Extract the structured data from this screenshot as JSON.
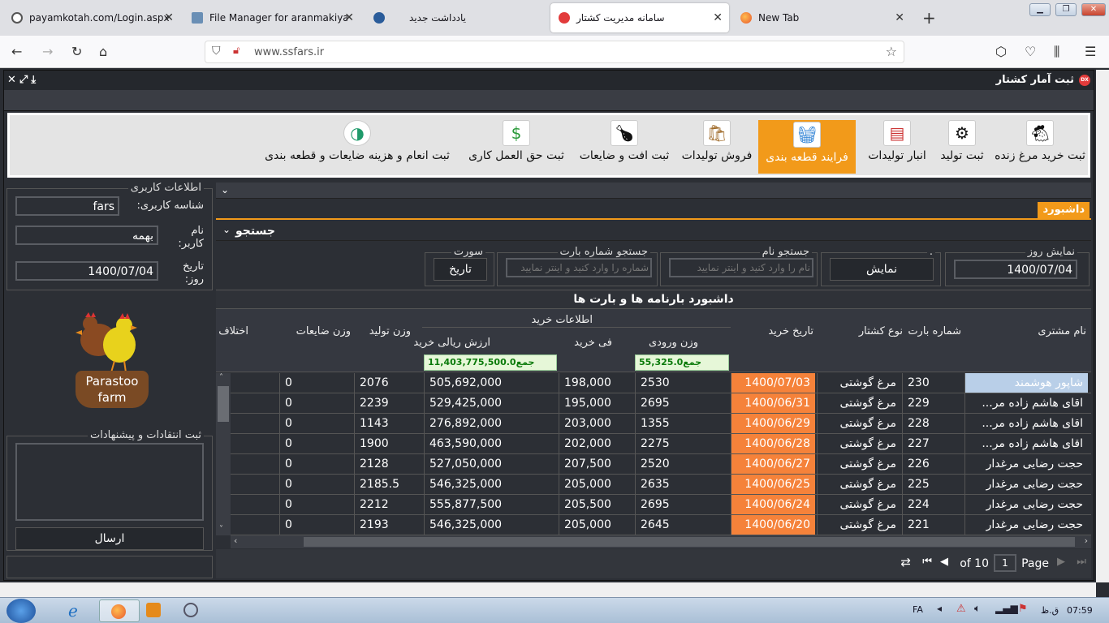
{
  "browser": {
    "tabs": [
      {
        "label": "payamkotah.com/Login.aspx",
        "close": "✕"
      },
      {
        "label": "File Manager for aranmakiyan.ir",
        "close": "✕"
      },
      {
        "label": "",
        "close": ""
      },
      {
        "label": "یادداشت جدید",
        "close": ""
      },
      {
        "label": "سامانه مدیریت کشتار",
        "close": "✕"
      },
      {
        "label": "New Tab",
        "close": "✕"
      }
    ],
    "new_tab": "+",
    "url": "www.ssfars.ir"
  },
  "app": {
    "title": "ثبت آمار کشتار",
    "title_logo": "DX",
    "ribbon": [
      {
        "label": "ثبت خرید مرغ زنده",
        "icon": "hen-icon"
      },
      {
        "label": "ثبت تولید",
        "icon": "production-icon"
      },
      {
        "label": "انبار تولیدات",
        "icon": "warehouse-icon"
      },
      {
        "label": "فرایند قطعه بندی",
        "icon": "basket-icon"
      },
      {
        "label": "فروش تولیدات",
        "icon": "sales-icon"
      },
      {
        "label": "ثبت افت و ضایعات",
        "icon": "waste-icon"
      },
      {
        "label": "ثبت حق العمل کاری",
        "icon": "money-icon"
      },
      {
        "label": "ثبت انعام و هزینه ضایعات و قطعه بندی",
        "icon": "cost-icon"
      }
    ]
  },
  "user_panel": {
    "legend": "اطلاعات کاربری",
    "id_label": "شناسه کاربری:",
    "id_value": "fars",
    "name_label_1": "نام",
    "name_label_2": "کاربر:",
    "name_value": "بهمه",
    "date_label_1": "تاریخ",
    "date_label_2": "روز:",
    "date_value": "1400/07/04"
  },
  "logo": {
    "line1": "Parastoo",
    "line2": "farm"
  },
  "feedback": {
    "legend": "ثبت انتقادات و پیشنهادات",
    "send": "ارسال"
  },
  "dashboard": {
    "tab": "داشبورد",
    "search_title": "جستجو",
    "show_day_legend": "نمایش روز",
    "show_day_value": "1400/07/04",
    "show_legend": ".",
    "show_button": "نمایش",
    "name_search_legend": "جستجو نام",
    "name_search_placeholder": "نام را وارد کنید و اینتر نمایید",
    "bar_search_legend": "جستجو شماره بارت",
    "bar_search_placeholder": "شماره را وارد کنید و اینتر نمایید",
    "sort_legend": "سورت",
    "sort_button": "تاریخ",
    "grid_title": "داشبورد بارنامه ها و بارت ها"
  },
  "grid": {
    "headers": {
      "customer": "نام مشتری",
      "bar_no": "شماره بارت",
      "type": "نوع کشتار",
      "date": "تاریخ خرید",
      "purchase_group": "اطلاعات خرید",
      "weight_in": "وزن ورودی",
      "unit_price": "فی خرید",
      "rial_value": "ارزش ریالی خرید",
      "prod_weight": "وزن تولید",
      "waste_weight": "وزن ضایعات",
      "diff": "اختلاف"
    },
    "sum_weight": "جمع55,325.0",
    "sum_value": "جمع11,403,775,500.0",
    "rows": [
      {
        "customer": "شاپور هوشمند",
        "bar": "230",
        "type": "مرغ گوشتی",
        "date": "1400/07/03",
        "weight": "2530",
        "price": "198,000",
        "value": "505,692,000",
        "prod": "2076",
        "waste": "0"
      },
      {
        "customer": "اقای هاشم زاده مر...",
        "bar": "229",
        "type": "مرغ گوشتی",
        "date": "1400/06/31",
        "weight": "2695",
        "price": "195,000",
        "value": "529,425,000",
        "prod": "2239",
        "waste": "0"
      },
      {
        "customer": "اقای هاشم زاده مر...",
        "bar": "228",
        "type": "مرغ گوشتی",
        "date": "1400/06/29",
        "weight": "1355",
        "price": "203,000",
        "value": "276,892,000",
        "prod": "1143",
        "waste": "0"
      },
      {
        "customer": "اقای هاشم زاده مر...",
        "bar": "227",
        "type": "مرغ گوشتی",
        "date": "1400/06/28",
        "weight": "2275",
        "price": "202,000",
        "value": "463,590,000",
        "prod": "1900",
        "waste": "0"
      },
      {
        "customer": "حجت رضایی مرغدار",
        "bar": "226",
        "type": "مرغ گوشتی",
        "date": "1400/06/27",
        "weight": "2520",
        "price": "207,500",
        "value": "527,050,000",
        "prod": "2128",
        "waste": "0"
      },
      {
        "customer": "حجت رضایی مرغدار",
        "bar": "225",
        "type": "مرغ گوشتی",
        "date": "1400/06/25",
        "weight": "2635",
        "price": "205,000",
        "value": "546,325,000",
        "prod": "2185.5",
        "waste": "0"
      },
      {
        "customer": "حجت رضایی مرغدار",
        "bar": "224",
        "type": "مرغ گوشتی",
        "date": "1400/06/24",
        "weight": "2695",
        "price": "205,500",
        "value": "555,877,500",
        "prod": "2212",
        "waste": "0"
      },
      {
        "customer": "حجت رضایی مرغدار",
        "bar": "221",
        "type": "مرغ گوشتی",
        "date": "1400/06/20",
        "weight": "2645",
        "price": "205,000",
        "value": "546,325,000",
        "prod": "2193",
        "waste": "0"
      }
    ],
    "pager": {
      "page_label": "Page",
      "page_value": "1",
      "of": "of 10"
    }
  },
  "taskbar": {
    "lang": "FA",
    "time": "07:59",
    "ampm": "ق.ظ"
  },
  "colors": {
    "accent": "#f29a1a",
    "date_cell": "#f5823a",
    "selected": "#b9cfe8"
  }
}
